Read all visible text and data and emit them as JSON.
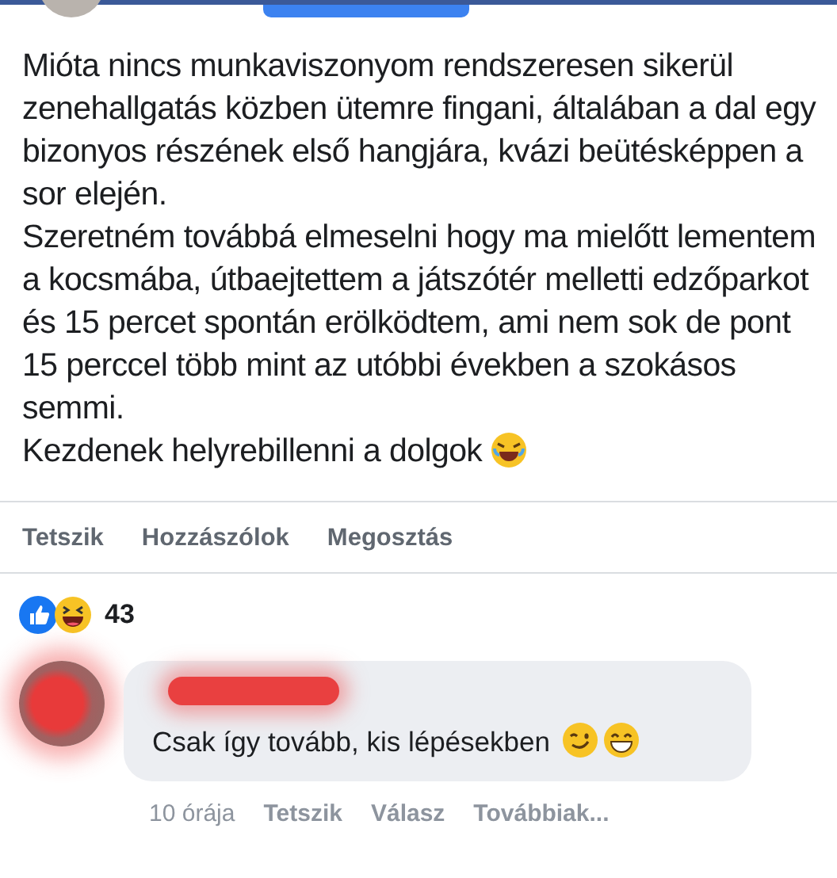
{
  "post": {
    "paragraphs": [
      "Mióta nincs munkaviszonyom rendszeresen sikerül zenehallgatás közben ütemre fingani, általában a dal egy bizonyos részének első hangjára, kvázi beütésképpen a sor elején.",
      "Szeretném továbbá elmeselni hogy ma mielőtt lementem a kocsmába, útbaejtettem a játszótér melletti edzőparkot és 15 percet spontán erölködtem, ami nem sok de pont 15 perccel több mint az utóbbi években a szokásos semmi.",
      "Kezdenek helyrebillenni a dolgok"
    ]
  },
  "actions": [
    "Tetszik",
    "Hozzászólok",
    "Megosztás"
  ],
  "reactions": {
    "count": "43"
  },
  "comment": {
    "text": "Csak így tovább, kis lépésekben",
    "time": "10 órája",
    "actions": [
      "Tetszik",
      "Válasz",
      "Továbbiak..."
    ]
  }
}
